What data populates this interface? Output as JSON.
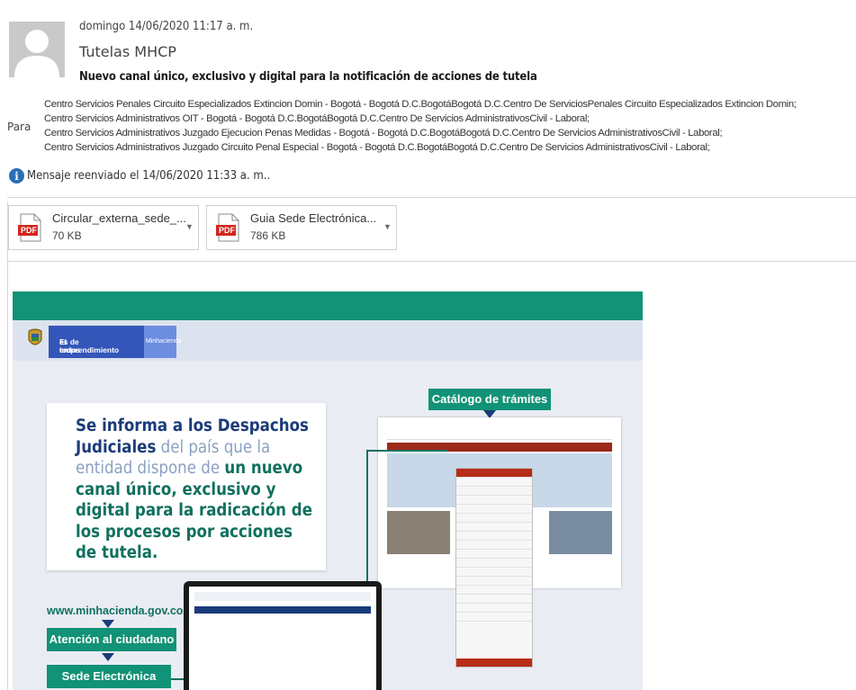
{
  "email": {
    "date": "domingo 14/06/2020 11:17 a. m.",
    "sender": "Tutelas MHCP",
    "subject": "Nuevo canal único, exclusivo y digital para la notificación de acciones de tutela",
    "to_label": "Para",
    "recipients": [
      "Centro Servicios Penales Circuito Especializados Extincion Domin - Bogotá - Bogotá D.C.BogotáBogotá D.C.Centro De ServiciosPenales Circuito Especializados Extincion Domin;",
      "Centro Servicios Administrativos OIT - Bogotá - Bogotá D.C.BogotáBogotá D.C.Centro De Servicios AdministrativosCivil - Laboral;",
      "Centro Servicios Administrativos Juzgado Ejecucion Penas Medidas - Bogotá - Bogotá D.C.BogotáBogotá D.C.Centro De Servicios AdministrativosCivil - Laboral;",
      "Centro Servicios Administrativos Juzgado Circuito Penal Especial - Bogotá - Bogotá D.C.BogotáBogotá D.C.Centro De Servicios AdministrativosCivil - Laboral;"
    ],
    "forwarded": "Mensaje reenviado el 14/06/2020 11:33 a. m..",
    "info_glyph": "i"
  },
  "attachments": [
    {
      "name": "Circular_externa_sede_...",
      "size": "70 KB",
      "icon": "pdf-icon"
    },
    {
      "name": "Guia Sede Electrónica...",
      "size": "786 KB",
      "icon": "pdf-icon"
    }
  ],
  "pdf_badge": "PDF",
  "flyer": {
    "brand_line1": "El emprendimiento",
    "brand_line2": "es de todos",
    "brand_ministry": "Minhacienda",
    "catalog_label": "Catálogo de trámites",
    "info_1": "Se informa a los Despachos Judiciales",
    "info_2": " del país que la entidad dispone de ",
    "info_3": "un nuevo canal único, exclusivo y digital para la radicación de los procesos por acciones de tutela.",
    "url": "www.minhacienda.gov.co",
    "atencion": "Atención al ciudadano",
    "sede": "Sede Electrónica",
    "colors": {
      "green": "#129276",
      "navy": "#1b3c7a",
      "blue": "#3456b8",
      "red": "#b72d18"
    }
  }
}
